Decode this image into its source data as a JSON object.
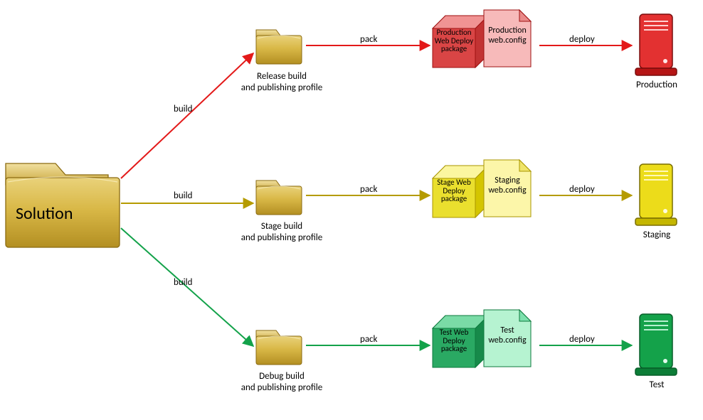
{
  "solution": {
    "label": "Solution"
  },
  "edges": {
    "build": "build",
    "pack": "pack",
    "deploy": "deploy"
  },
  "lanes": {
    "release": {
      "folder_label": "Release build\nand publishing profile",
      "package_label": "Production\nWeb\nDeploy\npackage",
      "config_label": "Production\nweb.config",
      "server_label": "Production",
      "color": "#e31919"
    },
    "stage": {
      "folder_label": "Stage build\nand publishing profile",
      "package_label": "Stage\nWeb\nDeploy\npackage",
      "config_label": "Staging\nweb.config",
      "server_label": "Staging",
      "color": "#d6c200"
    },
    "debug": {
      "folder_label": "Debug build\nand publishing profile",
      "package_label": "Test\nWeb\nDeploy\npackage",
      "config_label": "Test\nweb.config",
      "server_label": "Test",
      "color": "#13a24a"
    }
  }
}
